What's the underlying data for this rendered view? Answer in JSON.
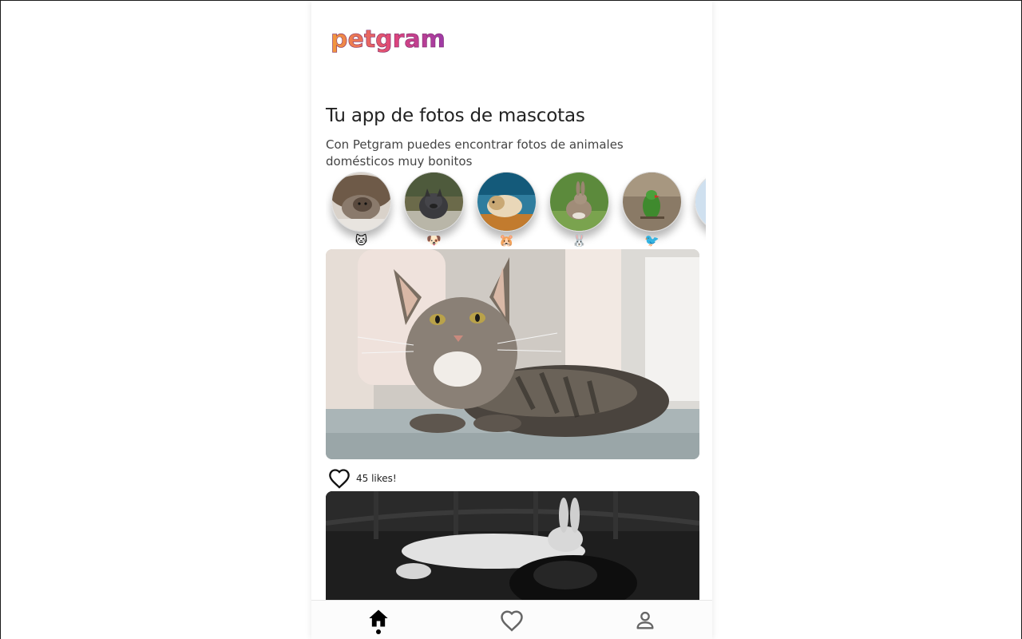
{
  "app": {
    "logo_text": "petgram"
  },
  "header": {
    "title": "Tu app de fotos de mascotas",
    "subtitle": "Con Petgram puedes encontrar fotos de animales domésticos muy bonitos"
  },
  "categories": [
    {
      "name": "cats",
      "emoji": "🐱"
    },
    {
      "name": "dogs",
      "emoji": "🐶"
    },
    {
      "name": "hamsters",
      "emoji": "🐹"
    },
    {
      "name": "rabbits",
      "emoji": "🐰"
    },
    {
      "name": "birds",
      "emoji": "🐦"
    }
  ],
  "feed": [
    {
      "subject": "cat",
      "likes_label": "45 likes!"
    },
    {
      "subject": "rabbit-and-dog"
    }
  ],
  "navbar": {
    "items": [
      "home-icon",
      "favorites-icon",
      "user-icon"
    ],
    "active": "home"
  },
  "colors": {
    "logo_gradient": [
      "#f39a3b",
      "#e0457b",
      "#9b3aa8"
    ],
    "text_primary": "#222222",
    "text_secondary": "#444444"
  }
}
